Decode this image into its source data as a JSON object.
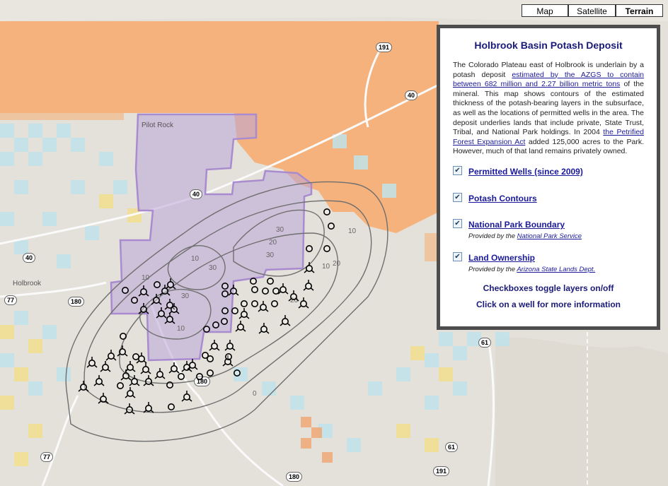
{
  "map_types": [
    {
      "label": "Map",
      "active": false
    },
    {
      "label": "Satellite",
      "active": false
    },
    {
      "label": "Terrain",
      "active": true
    }
  ],
  "panel": {
    "title": "Holbrook Basin Potash Deposit",
    "desc_1": "The Colorado Plateau east of Holbrook is underlain by a potash deposit ",
    "link_1": "estimated by the AZGS to contain between 682 million and 2.27 billion metric tons",
    "desc_2": " of the mineral. This map shows contours of the estimated thickness of the potash-bearing layers in the subsurface, as well as the locations of permitted wells in the area. The deposit underlies lands that include private, State Trust, Tribal, and National Park holdings. In 2004 ",
    "link_2": "the Petrified Forest Expansion Act",
    "desc_3": " added 125,000 acres to the Park. However, much of that land remains privately owned.",
    "layers": [
      {
        "label": "Permitted Wells (since 2009)",
        "checked": true,
        "provider_prefix": "",
        "provider": ""
      },
      {
        "label": "Potash Contours",
        "checked": true,
        "provider_prefix": "",
        "provider": ""
      },
      {
        "label": "National Park Boundary",
        "checked": true,
        "provider_prefix": "Provided by the ",
        "provider": "National Park Service"
      },
      {
        "label": "Land Ownership",
        "checked": true,
        "provider_prefix": "Provided by the ",
        "provider": "Arizona State Lands Dept."
      }
    ],
    "note_1": "Checkboxes toggle layers on/off",
    "note_2": "Click on a well for more information"
  },
  "map_labels": {
    "pilot_rock": "Pilot Rock",
    "holbrook": "Holbrook"
  },
  "road_shields": [
    "191",
    "40",
    "40",
    "40",
    "77",
    "180",
    "180",
    "61",
    "61",
    "77",
    "180",
    "191"
  ],
  "contour_labels": [
    "10",
    "10",
    "20",
    "30",
    "30",
    "30",
    "10",
    "10",
    "20",
    "30",
    "0",
    "10",
    "20"
  ],
  "colors": {
    "private_land": "#f5b27c",
    "state_trust": "#bfe3ea",
    "state_trust_alt": "#f3df8e",
    "park_fill": "#b9a6d8",
    "park_border": "#a98bd0",
    "contour": "#6f6f6f",
    "panel_title": "#1a1a7a",
    "link": "#1a1a9a"
  }
}
